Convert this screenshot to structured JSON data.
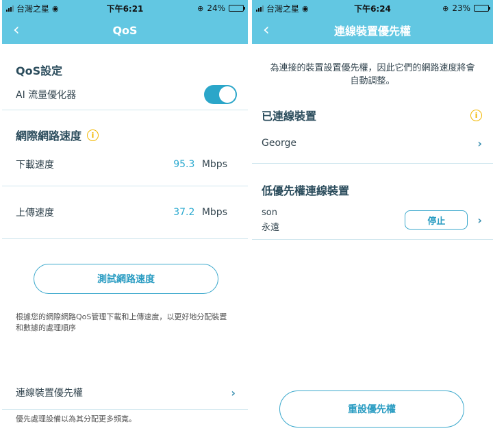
{
  "left": {
    "status": {
      "carrier": "台灣之星",
      "time": "下午6:21",
      "battery": "24%",
      "battery_level": 0.24
    },
    "nav": {
      "back": "‹",
      "title": "QoS"
    },
    "qos_section": {
      "title": "QoS設定",
      "ai_label": "AI 流量優化器",
      "ai_enabled": true
    },
    "speed_section": {
      "title": "網際網路速度",
      "download_label": "下載速度",
      "download_value": "95.3",
      "download_unit": "Mbps",
      "upload_label": "上傳速度",
      "upload_value": "37.2",
      "upload_unit": "Mbps"
    },
    "test_button": "測試網路速度",
    "description": "根據您的網際網路QoS管理下載和上傳速度，以更好地分配裝置和數據的處理順序",
    "priority_item": "連線裝置優先權",
    "priority_note": "優先處理設備以為其分配更多頻寬。"
  },
  "right": {
    "status": {
      "carrier": "台灣之星",
      "time": "下午6:24",
      "battery": "23%",
      "battery_level": 0.23
    },
    "nav": {
      "back": "‹",
      "title": "連線裝置優先權"
    },
    "intro": "為連接的裝置設置優先權，因此它們的網路速度將會自動調整。",
    "connected_title": "已連線裝置",
    "connected_devices": [
      {
        "name": "George"
      }
    ],
    "low_title": "低優先權連線裝置",
    "low_devices": [
      {
        "name": "son",
        "duration": "永遠",
        "action": "停止"
      }
    ],
    "reset_button": "重設優先權"
  }
}
